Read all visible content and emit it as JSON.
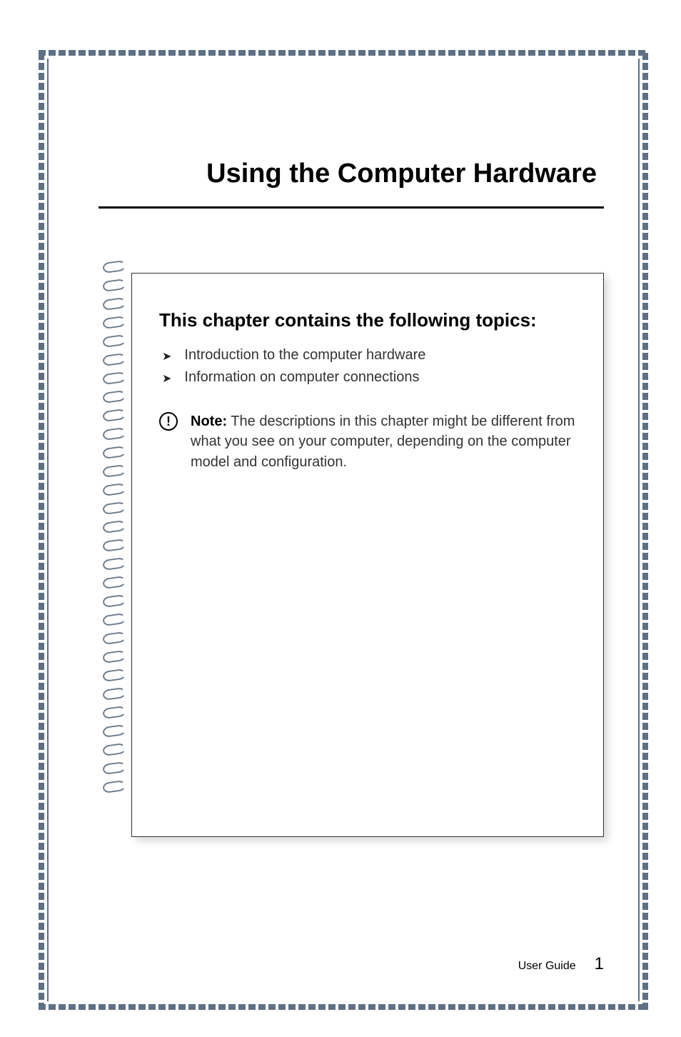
{
  "chapter": {
    "title": "Using the Computer Hardware"
  },
  "topics": {
    "heading": "This chapter contains the following topics:",
    "items": [
      "Introduction to the computer hardware",
      "Information on computer connections"
    ]
  },
  "note": {
    "label": "Note:",
    "text": " The descriptions in this chapter might be different from what you see on your computer, depending on the computer model and configuration."
  },
  "footer": {
    "label": "User Guide",
    "page": "1"
  }
}
